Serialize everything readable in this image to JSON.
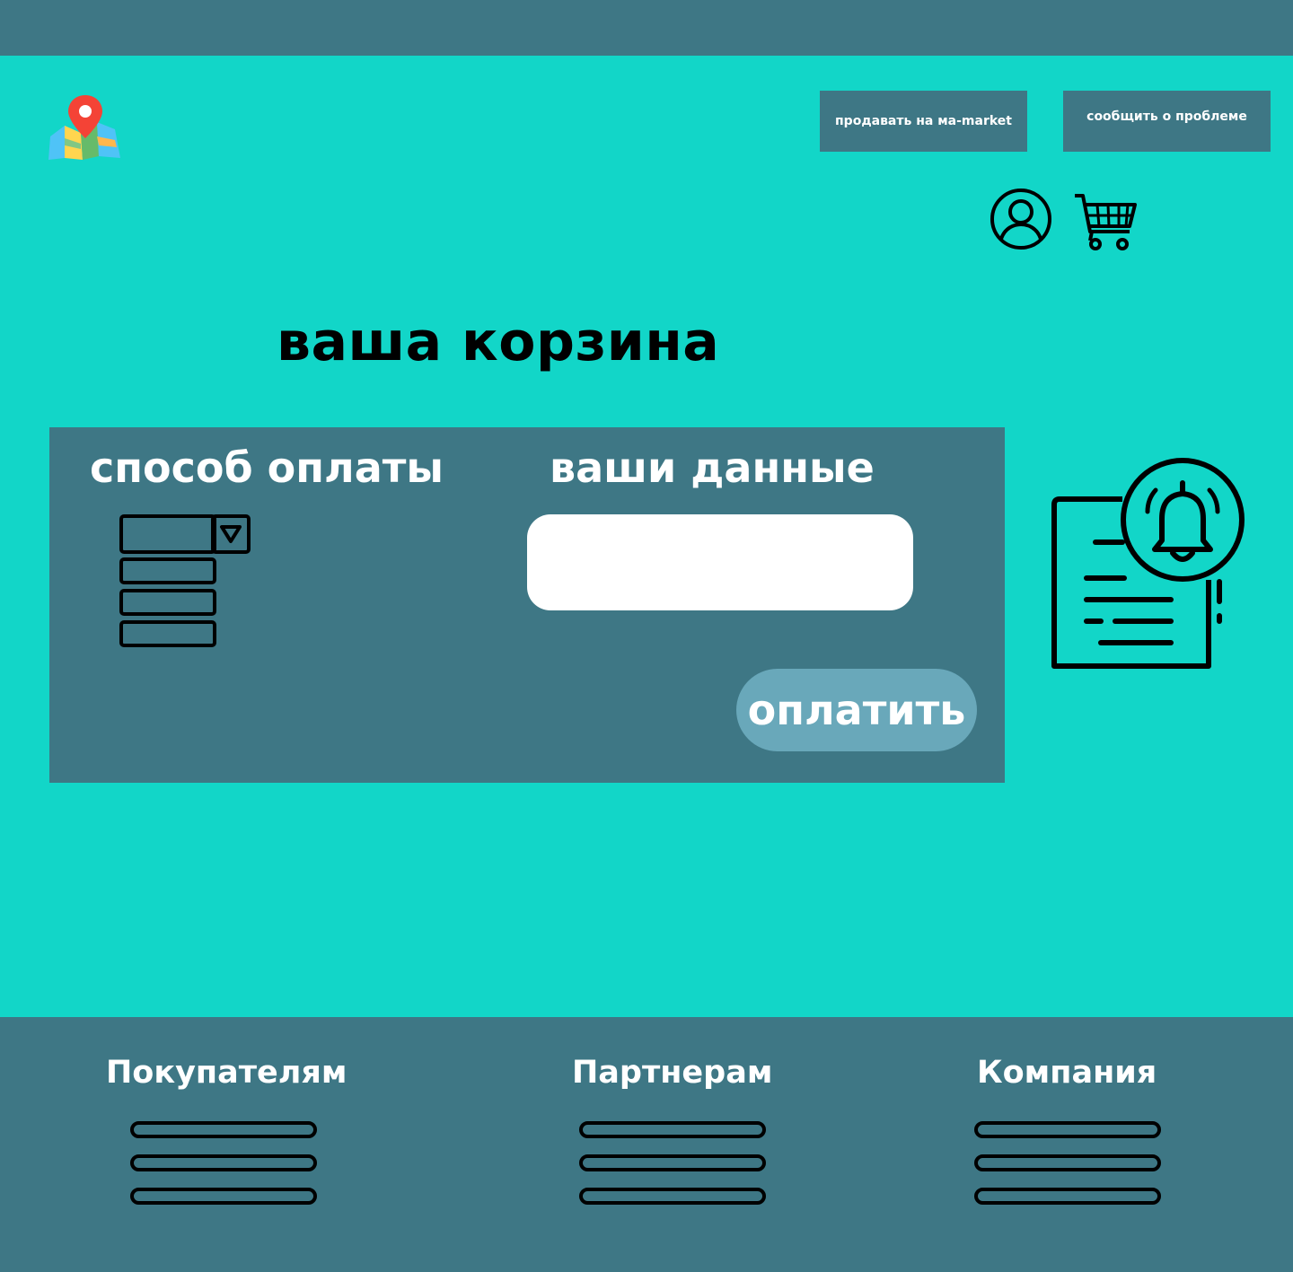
{
  "header": {
    "logo_icon": "map-pin-logo-icon",
    "sell_button_label": "продавать на ма-market",
    "report_button_label": "сообщить о проблеме",
    "account_icon": "user-account-icon",
    "cart_icon": "shopping-cart-icon"
  },
  "main": {
    "title": "ваша корзина",
    "payment": {
      "heading": "способ оплаты",
      "select_icon": "dropdown-list-icon",
      "options_count_shown": 3
    },
    "user_data": {
      "heading": "ваши данные",
      "input_value": "",
      "input_placeholder": ""
    },
    "pay_button_label": "оплатить",
    "notice_icon": "document-bell-icon"
  },
  "footer": {
    "columns": [
      {
        "heading": "Покупателям",
        "links": [
          "",
          "",
          ""
        ]
      },
      {
        "heading": "Партнерам",
        "links": [
          "",
          "",
          ""
        ]
      },
      {
        "heading": "Компания",
        "links": [
          "",
          "",
          ""
        ]
      }
    ]
  },
  "colors": {
    "background_accent": "#12D6C8",
    "panel_and_bars": "#3E7785",
    "pay_button": "#69A8BA",
    "text_light": "#FFFFFF",
    "text_dark": "#000000"
  }
}
